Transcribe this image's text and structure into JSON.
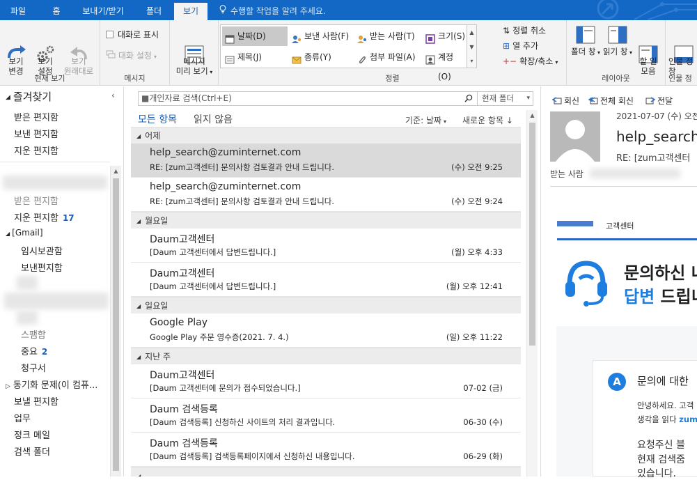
{
  "ribbon_tabs": [
    {
      "label": "파일"
    },
    {
      "label": "홈"
    },
    {
      "label": "보내기/받기"
    },
    {
      "label": "폴더"
    },
    {
      "label": "보기"
    }
  ],
  "active_tab": "보기",
  "tell_me": "수행할 작업을 알려 주세요.",
  "groups": {
    "current_view": {
      "label": "현재 보기",
      "change_view": "보기\n변경",
      "view_settings": "보기\n설정",
      "reset_view": "보기\n원래대로"
    },
    "messages": {
      "label": "메시지",
      "show_as_conversations": "대화로 표시",
      "conversation_settings": "대화 설정"
    },
    "message_preview": {
      "label": "메시지\n미리 보기"
    },
    "arrangement": {
      "label": "정렬",
      "items": [
        "날짜(D)",
        "보낸 사람(F)",
        "받는 사람(T)",
        "크기(S)",
        "제목(J)",
        "종류(Y)",
        "첨부 파일(A)",
        "계정(O)"
      ],
      "selected": "날짜(D)",
      "reverse_sort": "정렬 취소",
      "add_columns": "열 추가",
      "expand_collapse": "확장/축소"
    },
    "layout": {
      "label": "레이아웃",
      "folder_pane": "폴더 창",
      "reading_pane": "읽기 창",
      "todo_bar": "할 일\n모음"
    },
    "people": {
      "label": "인물 정",
      "people_pane": "인물 정\n창"
    }
  },
  "nav": {
    "favorites_title": "즐겨찾기",
    "favorites": [
      "받은 편지함",
      "보낸 편지함",
      "지운 편지함"
    ],
    "folders": [
      {
        "label": "받은 편지함",
        "count": ""
      },
      {
        "label": "지운 편지함",
        "count": "17"
      },
      {
        "label": "[Gmail]",
        "count": ""
      },
      {
        "label": "임시보관함",
        "count": ""
      },
      {
        "label": "보낸편지함",
        "count": ""
      },
      {
        "label": "스팸함",
        "count": ""
      },
      {
        "label": "중요",
        "count": "2"
      },
      {
        "label": "청구서",
        "count": ""
      },
      {
        "label": "동기화 문제(이 컴퓨...",
        "count": ""
      },
      {
        "label": "보낼 편지함",
        "count": ""
      },
      {
        "label": "업무",
        "count": ""
      },
      {
        "label": "정크 메일",
        "count": ""
      },
      {
        "label": "검색 폴더",
        "count": ""
      }
    ]
  },
  "list": {
    "search_placeholder": "개인자료 검색(Ctrl+E)",
    "scope": "현재 폴더",
    "filter_all": "모든 항목",
    "filter_unread": "읽지 않음",
    "sort_by": "기준: 날짜",
    "sort_order": "새로운 항목 ↓",
    "groups": [
      {
        "name": "어제",
        "messages": [
          {
            "sender": "help_search@zuminternet.com",
            "subject": "RE: [zum고객센터] 문의사항 검토결과 안내 드립니다.",
            "time": "(수) 오전 9:25"
          },
          {
            "sender": "help_search@zuminternet.com",
            "subject": "RE: [zum고객센터] 문의사항 검토결과 안내 드립니다.",
            "time": "(수) 오전 9:24"
          }
        ]
      },
      {
        "name": "월요일",
        "messages": [
          {
            "sender": "Daum고객센터",
            "subject": "[Daum 고객센터에서 답변드립니다.]",
            "time": "(월) 오후 4:33"
          },
          {
            "sender": "Daum고객센터",
            "subject": "[Daum 고객센터에서 답변드립니다.]",
            "time": "(월) 오후 12:41"
          }
        ]
      },
      {
        "name": "일요일",
        "messages": [
          {
            "sender": "Google Play",
            "subject": "Google Play 주문 영수증(2021. 7. 4.)",
            "time": "(일) 오후 11:22"
          }
        ]
      },
      {
        "name": "지난 주",
        "messages": [
          {
            "sender": "Daum고객센터",
            "subject": "[Daum 고객센터에 문의가 접수되었습니다.]",
            "time": "07-02 (금)"
          },
          {
            "sender": "Daum 검색등록",
            "subject": "[Daum 검색등록] 신청하신 사이트의 처리 결과입니다.",
            "time": "06-30 (수)"
          },
          {
            "sender": "Daum 검색등록",
            "subject": "[Daum 검색등록] 검색등록페이지에서 신청하신 내용입니다.",
            "time": "06-29 (화)"
          }
        ]
      }
    ]
  },
  "reading": {
    "reply": "회신",
    "reply_all": "전체 회신",
    "forward": "전달",
    "date": "2021-07-07 (수) 오전",
    "from": "help_search@",
    "subject": "RE: [zum고객센터",
    "to_label": "받는 사람",
    "body": {
      "logo_tail": "고객센터",
      "title_line1": "문의하신 내",
      "title_line2_highlight": "답변",
      "title_line2_rest": " 드립니",
      "card_badge": "A",
      "card_question": "문의에 대한",
      "p1": "안녕하세요. 고객",
      "p2_prefix": "생각을 읽다 ",
      "p2_link": "zum",
      "p3": "요청주신 블",
      "p4": "현재 검색줌",
      "p5": "있습니다."
    }
  },
  "colors": {
    "ribbon_blue": "#1268c4",
    "accent_blue": "#1a5fb4",
    "zum_blue": "#1e7ee0",
    "selected_row": "#dadada"
  }
}
